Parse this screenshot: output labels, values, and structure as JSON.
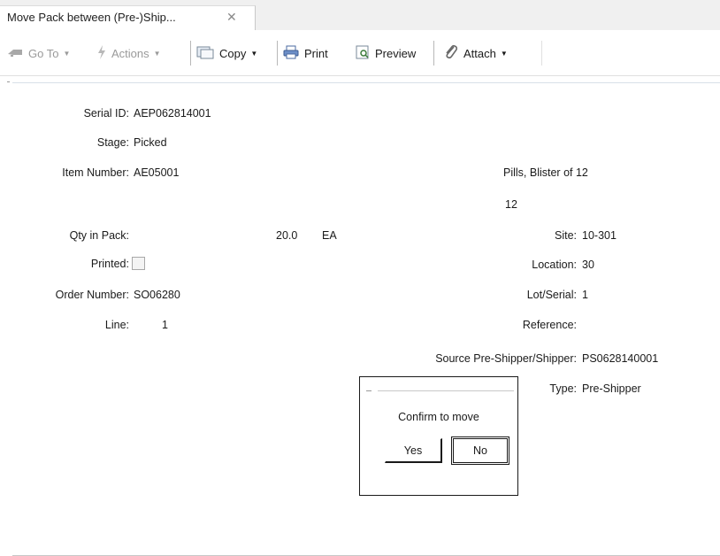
{
  "tab": {
    "title": "Move Pack between (Pre-)Ship...",
    "close_glyph": "✕"
  },
  "toolbar": {
    "goto_label": "Go To",
    "actions_label": "Actions",
    "copy_label": "Copy",
    "print_label": "Print",
    "preview_label": "Preview",
    "attach_label": "Attach",
    "caret": "▼"
  },
  "form": {
    "serial_id": {
      "label": "Serial ID:",
      "value": "AEP062814001"
    },
    "stage": {
      "label": "Stage:",
      "value": "Picked"
    },
    "item_number": {
      "label": "Item Number:",
      "value": "AE05001"
    },
    "item_description": "Pills, Blister of 12",
    "item_extra": "12",
    "qty_in_pack": {
      "label": "Qty in Pack:",
      "value": "20.0",
      "uom": "EA"
    },
    "printed": {
      "label": "Printed:",
      "checked": false
    },
    "order_number": {
      "label": "Order Number:",
      "value": "SO06280"
    },
    "line": {
      "label": "Line:",
      "value": "1"
    },
    "site": {
      "label": "Site:",
      "value": "10-301"
    },
    "location": {
      "label": "Location:",
      "value": "30"
    },
    "lot_serial": {
      "label": "Lot/Serial:",
      "value": "1"
    },
    "reference": {
      "label": "Reference:",
      "value": ""
    },
    "source_shipper": {
      "label": "Source Pre-Shipper/Shipper:",
      "value": "PS0628140001"
    },
    "type": {
      "label": "Type:",
      "value": "Pre-Shipper"
    }
  },
  "dialog": {
    "message": "Confirm to move",
    "yes_label": "Yes",
    "no_label": "No"
  },
  "icons": [
    "goto-icon",
    "actions-icon",
    "copy-icon",
    "print-icon",
    "preview-icon",
    "attach-icon"
  ]
}
